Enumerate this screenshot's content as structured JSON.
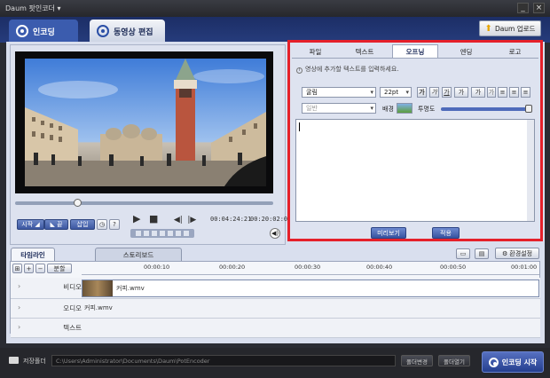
{
  "window": {
    "title": "Daum 팟인코더 ▾",
    "minimize": "_",
    "close": "×"
  },
  "main_tabs": [
    {
      "label": "인코딩"
    },
    {
      "label": "동영상 편집"
    }
  ],
  "upload_button": "Daum 업로드",
  "player": {
    "buttons": {
      "start": "시작 ◢",
      "end": "◣ 끝",
      "insert": "삽입",
      "help": "?"
    },
    "current_time": "00:04:24:21",
    "total_time": "00:20:02:05"
  },
  "editor": {
    "tabs": [
      "파일",
      "텍스트",
      "오프닝",
      "엔딩",
      "로고"
    ],
    "active_tab": "오프닝",
    "hint": "영상에 추가할 텍스트를 입력하세요.",
    "font": "굴림",
    "font_size": "22pt",
    "format_buttons": [
      "가",
      "가",
      "가",
      "가",
      "가",
      "가"
    ],
    "align_buttons": [
      "≡",
      "≡",
      "≡"
    ],
    "style_select": "일반",
    "background_label": "배경",
    "opacity_label": "투명도",
    "opacity_value": 1.0,
    "preview_button": "미리보기",
    "apply_button": "적용"
  },
  "lower_tabs": [
    "타임라인",
    "스토리보드"
  ],
  "settings_button": "환경설정",
  "timeline": {
    "zoom_label": "분할",
    "ticks": [
      "00:00:10",
      "00:00:20",
      "00:00:30",
      "00:00:40",
      "00:00:50",
      "00:01:00"
    ],
    "tracks": [
      {
        "name": "비디오",
        "clip": "커피.wmv"
      },
      {
        "name": "오디오",
        "clip": "커피.wmv"
      },
      {
        "name": "텍스트",
        "clip": ""
      }
    ]
  },
  "bottom": {
    "save_label": "저장폴더",
    "save_path": "C:\\Users\\Administrator\\Documents\\Daum\\PotEncoder",
    "change_folder": "폴더변경",
    "open_folder": "폴더열기",
    "encode_button": "인코딩 시작"
  },
  "colors": {
    "accent": "#3b5cae",
    "highlight": "#e5202a"
  }
}
